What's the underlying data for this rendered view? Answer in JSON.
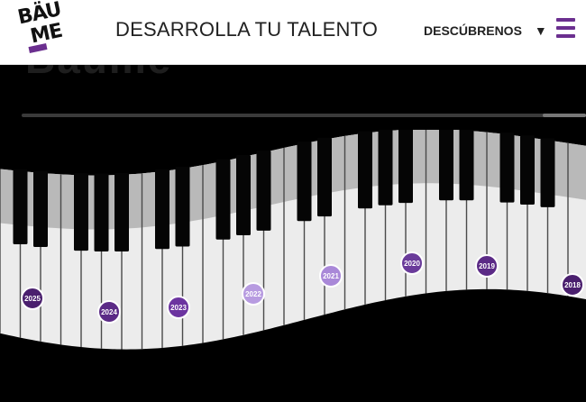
{
  "header": {
    "logo": {
      "line1": "BÄU",
      "line2": "ME"
    },
    "tagline": "DESARROLLA TU TALENTO",
    "nav_label": "DESCÚBRENOS",
    "nav_caret": "▼",
    "menu_icon": "hamburger-icon"
  },
  "section": {
    "title_partial": "Baume"
  },
  "colors": {
    "brand": "#6b2f8f",
    "background": "#000000",
    "header": "#ffffff"
  },
  "timeline": {
    "years": [
      {
        "label": "2025",
        "color": "#4a1f6e"
      },
      {
        "label": "2024",
        "color": "#5b2a86"
      },
      {
        "label": "2023",
        "color": "#6c34a0"
      },
      {
        "label": "2022",
        "color": "#b79be0"
      },
      {
        "label": "2021",
        "color": "#a988d8"
      },
      {
        "label": "2020",
        "color": "#6a3b9a"
      },
      {
        "label": "2019",
        "color": "#5b2a86"
      },
      {
        "label": "2018",
        "color": "#4a1f6e"
      }
    ]
  }
}
